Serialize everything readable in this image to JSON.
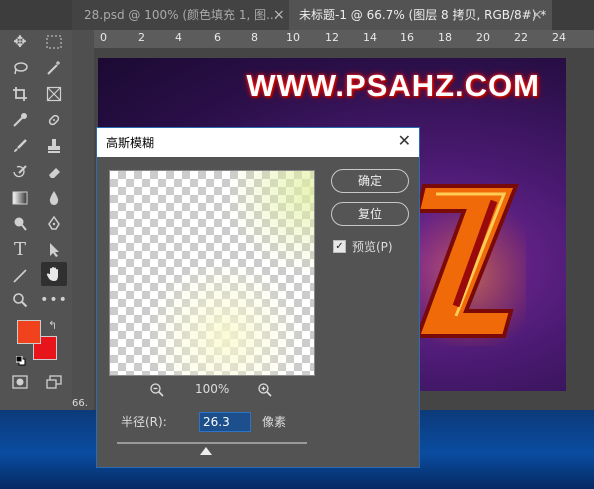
{
  "tabs": [
    {
      "label": "28.psd @ 100% (颜色填充 1, 图...",
      "close": "×"
    },
    {
      "label": "未标题-1 @ 66.7% (图层 8 拷贝, RGB/8#) *",
      "close": "×"
    }
  ],
  "ruler": {
    "labels": [
      "0",
      "2",
      "4",
      "6",
      "8",
      "10",
      "12",
      "14",
      "16",
      "18",
      "20",
      "22",
      "24"
    ]
  },
  "canvas": {
    "site_text": "WWW.PSAHZ.COM"
  },
  "status": {
    "zoom": "66."
  },
  "toolbar": {
    "tools": [
      "move-icon",
      "marquee-icon",
      "lasso-icon",
      "magic-wand-icon",
      "crop-icon",
      "frame-icon",
      "eyedropper-icon",
      "healing-brush-icon",
      "brush-icon",
      "clone-stamp-icon",
      "history-brush-icon",
      "eraser-icon",
      "gradient-icon",
      "blur-icon",
      "dodge-icon",
      "pen-icon",
      "type-icon",
      "path-select-icon",
      "line-icon",
      "hand-icon",
      "zoom-icon",
      "more-icon"
    ],
    "foreground_color": "#f0421c",
    "background_color": "#e8141c"
  },
  "dialog": {
    "title": "高斯模糊",
    "ok": "确定",
    "reset": "复位",
    "preview_label": "预览(P)",
    "preview_checked": true,
    "zoom_percent": "100%",
    "radius_label": "半径(R):",
    "radius_value": "26.3",
    "radius_unit": "像素",
    "slider_fraction": 0.47
  },
  "colors": {
    "accent": "#2b6cb0",
    "panel": "#535353",
    "desktop": "#0a4ca0"
  }
}
